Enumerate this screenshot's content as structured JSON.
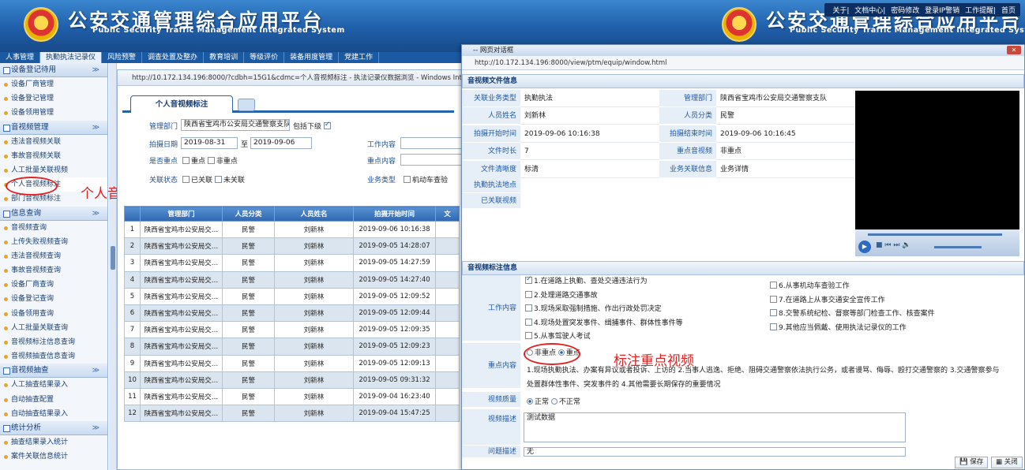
{
  "banner": {
    "title": "公安交通管理综合应用平台",
    "subtitle": "Public Security Traffic Management Integrated System"
  },
  "toplinks": [
    "关于",
    "文档中心",
    "密码修改",
    "登录IP警销",
    "工作提醒",
    "首页"
  ],
  "mainnav": [
    "人事管理",
    "执勤执法记录仪",
    "风险预警",
    "调查处置及整办",
    "教育培训",
    "等级评价",
    "装备用度管理",
    "党建工作"
  ],
  "sidebar": {
    "sections": [
      {
        "title": "设备登记待用",
        "items": [
          "设备厂商管理",
          "设备登记管理",
          "设备领用管理"
        ]
      },
      {
        "title": "音视频管理",
        "items": [
          "违法音视频关联",
          "事故音视频关联",
          "人工批量关联视频",
          "个人音视频标注",
          "部门音视频标注"
        ]
      },
      {
        "title": "信息查询",
        "items": [
          "音视频查询",
          "上传失败视频查询",
          "违法音视频查询",
          "事故音视频查询",
          "设备厂商查询",
          "设备登记查询",
          "设备领用查询",
          "人工批量关联查询",
          "音视频标注信息查询",
          "音视频抽查信息查询"
        ]
      },
      {
        "title": "音视频抽查",
        "items": [
          "人工抽查结果录入",
          "自动抽查配置",
          "自动抽查结果录入"
        ]
      },
      {
        "title": "统计分析",
        "items": [
          "抽查结果录入统计",
          "案件关联信息统计"
        ]
      }
    ]
  },
  "annotations": {
    "left": "个人音视频标注",
    "right": "标注重点视频"
  },
  "bgwin": {
    "address": "http://10.172.134.196:8000/?cdbh=15G1&cdmc=个人音视频标注 - 执法记录仪数据浏览 - Windows Internet",
    "tab": "个人音视频标注",
    "form": {
      "dept_label": "管理部门",
      "dept_value": "陕西省宝鸡市公安局交通警察支队",
      "include_sub": "包括下级",
      "date_label": "拍摄日期",
      "date_from": "2019-08-31",
      "date_to_sep": "至",
      "date_to": "2019-09-06",
      "work_label": "工作内容",
      "key_label": "是否重点",
      "key_opt1": "重点",
      "key_opt2": "非重点",
      "keycontent_label": "重点内容",
      "link_label": "关联状态",
      "link_opt1": "已关联",
      "link_opt2": "未关联",
      "biz_label": "业务类型",
      "biz_opt1": "机动车查验"
    },
    "table": {
      "headers": [
        "",
        "管理部门",
        "人员分类",
        "人员姓名",
        "拍摄开始时间",
        "文"
      ],
      "rows": [
        [
          "1",
          "陕西省宝鸡市公安局交…",
          "民警",
          "刘新林",
          "2019-09-06 10:16:38"
        ],
        [
          "2",
          "陕西省宝鸡市公安局交…",
          "民警",
          "刘新林",
          "2019-09-05 14:28:07"
        ],
        [
          "3",
          "陕西省宝鸡市公安局交…",
          "民警",
          "刘新林",
          "2019-09-05 14:27:59"
        ],
        [
          "4",
          "陕西省宝鸡市公安局交…",
          "民警",
          "刘新林",
          "2019-09-05 14:27:40"
        ],
        [
          "5",
          "陕西省宝鸡市公安局交…",
          "民警",
          "刘新林",
          "2019-09-05 12:09:52"
        ],
        [
          "6",
          "陕西省宝鸡市公安局交…",
          "民警",
          "刘新林",
          "2019-09-05 12:09:44"
        ],
        [
          "7",
          "陕西省宝鸡市公安局交…",
          "民警",
          "刘新林",
          "2019-09-05 12:09:35"
        ],
        [
          "8",
          "陕西省宝鸡市公安局交…",
          "民警",
          "刘新林",
          "2019-09-05 12:09:23"
        ],
        [
          "9",
          "陕西省宝鸡市公安局交…",
          "民警",
          "刘新林",
          "2019-09-05 12:09:13"
        ],
        [
          "10",
          "陕西省宝鸡市公安局交…",
          "民警",
          "刘新林",
          "2019-09-05 09:31:32"
        ],
        [
          "11",
          "陕西省宝鸡市公安局交…",
          "民警",
          "刘新林",
          "2019-09-04 16:23:40"
        ],
        [
          "12",
          "陕西省宝鸡市公安局交…",
          "民警",
          "刘新林",
          "2019-09-04 15:47:25"
        ]
      ]
    }
  },
  "dialog": {
    "title": "-- 网页对话框",
    "address": "http://10.172.134.196:8000/view/ptm/equip/window.html",
    "sect1": "音视频文件信息",
    "info": [
      {
        "l": "关联业务类型",
        "v": "执勤执法",
        "l2": "管理部门",
        "v2": "陕西省宝鸡市公安局交通警察支队"
      },
      {
        "l": "人员姓名",
        "v": "刘新林",
        "l2": "人员分类",
        "v2": "民警"
      },
      {
        "l": "拍摄开始时间",
        "v": "2019-09-06 10:16:38",
        "l2": "拍摄结束时间",
        "v2": "2019-09-06 10:16:45"
      },
      {
        "l": "文件时长",
        "v": "7",
        "l2": "重点音视频",
        "v2": "非重点"
      },
      {
        "l": "文件清晰度",
        "v": "标清",
        "l2": "业务关联信息",
        "v2": "业务详情"
      }
    ],
    "extra_labels": [
      "执勤执法地点",
      "已关联视频"
    ],
    "sect2": "音视频标注信息",
    "work_label": "工作内容",
    "work_items_left": [
      "1.在道路上执勤、查处交通违法行为",
      "2.处理道路交通事故",
      "3.现场采取强制措施、作出行政处罚决定",
      "4.现场处置突发事件、缉捕事件、群体性事件等",
      "5.从事驾驶人考试"
    ],
    "work_items_right": [
      "6.从事机动车查验工作",
      "7.在道路上从事交通安全宣传工作",
      "8.交警系统纪检、督察等部门检查工作、核查案件",
      "9.其他应当佩戴、使用执法记录仪的工作"
    ],
    "key_label": "重点内容",
    "key_radio": [
      "非重点",
      "重点"
    ],
    "key_line1": "1.现场执勤执法、办案有异议或者投诉、上访的  2.当事人逃逸、拒绝、阻碍交通警察依法执行公务，或者谩骂、侮辱、殴打交通警察的  3.交通警察参与",
    "key_line2": "处置群体性事件、突发事件的  4.其他需要长期保存的重要情况",
    "quality_label": "视频质量",
    "quality_radio": [
      "正常",
      "不正常"
    ],
    "desc_label": "视频描述",
    "desc_value": "测试数据",
    "issue_label": "问题描述",
    "issue_value": "无",
    "save": "保存",
    "close": "关闭"
  }
}
